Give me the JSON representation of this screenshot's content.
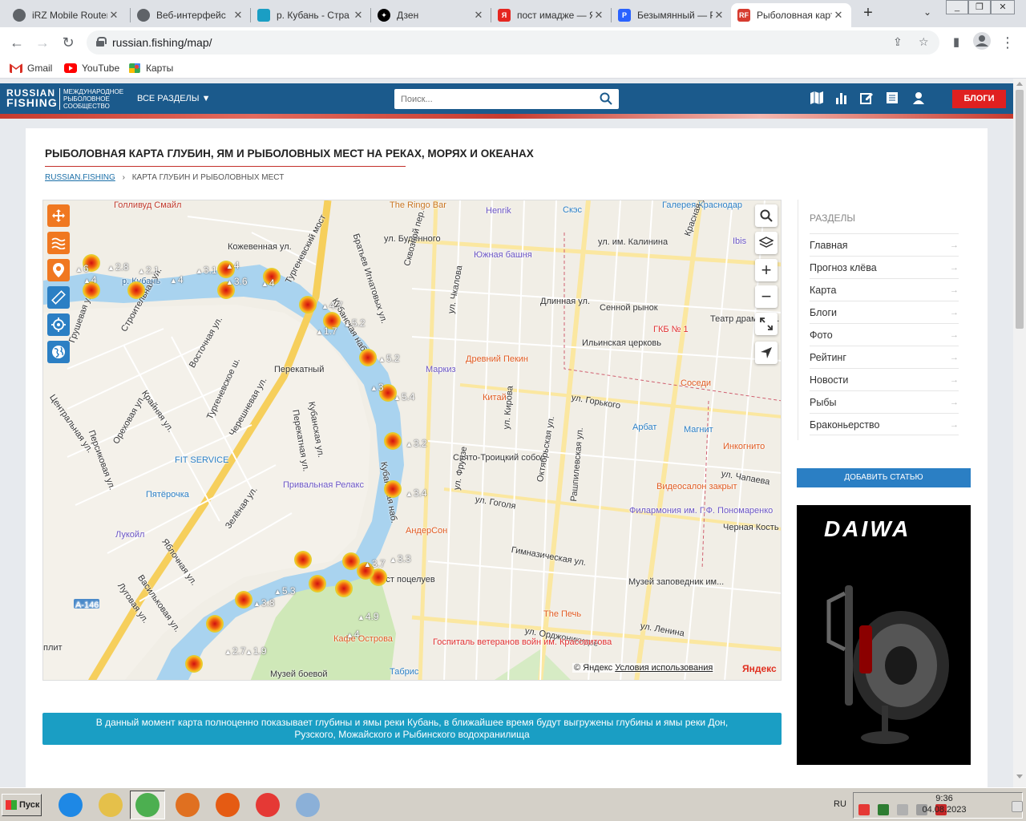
{
  "browser": {
    "tabs": [
      {
        "title": "iRZ Mobile Router",
        "active": false,
        "icon": "globe-icon",
        "color": "#5f6368"
      },
      {
        "title": "Веб-интерфейс",
        "active": false,
        "icon": "globe-icon",
        "color": "#5f6368"
      },
      {
        "title": "р. Кубань - Стра",
        "active": false,
        "icon": "chat-icon",
        "color": "#1a9ec4"
      },
      {
        "title": "Дзен",
        "active": false,
        "icon": "dzen-icon",
        "color": "#000000"
      },
      {
        "title": "пост имадже — Я",
        "active": false,
        "icon": "yandex-icon",
        "color": "#e52620"
      },
      {
        "title": "Безымянный — Р",
        "active": false,
        "icon": "doc-icon",
        "color": "#2962ff"
      },
      {
        "title": "Рыболовная карт",
        "active": true,
        "icon": "rf-icon",
        "color": "#d63b2f"
      }
    ],
    "url": "russian.fishing/map/",
    "bookmarks": [
      {
        "label": "Gmail",
        "icon": "gmail-icon",
        "color": "#d93025"
      },
      {
        "label": "YouTube",
        "icon": "youtube-icon",
        "color": "#ff0000"
      },
      {
        "label": "Карты",
        "icon": "maps-icon",
        "color": "#34a853"
      }
    ]
  },
  "site": {
    "logo_line1": "RUSSIAN",
    "logo_line2": "FISHING",
    "logo_sub": "МЕЖДУНАРОДНОЕ РЫБОЛОВНОЕ СООБЩЕСТВО",
    "all_sections": "ВСЕ РАЗДЕЛЫ ▼",
    "search_placeholder": "Поиск...",
    "blogs_button": "БЛОГИ",
    "page_title": "РЫБОЛОВНАЯ КАРТА ГЛУБИН, ЯМ И РЫБОЛОВНЫХ МЕСТ НА РЕКАХ, МОРЯХ И ОКЕАНАХ",
    "breadcrumb_home": "RUSSIAN.FISHING",
    "breadcrumb_sep": "›",
    "breadcrumb_current": "КАРТА ГЛУБИН И РЫБОЛОВНЫХ МЕСТ",
    "notice_line1": "В данный момент карта полноценно показывает глубины и ямы реки Кубань, в ближайшее время будут выгружены глубины и ямы реки Дон,",
    "notice_line2": "Рузского, Можайского и Рыбинского водохранилища",
    "sidebar_heading": "РАЗДЕЛЫ",
    "sidebar_items": [
      "Главная",
      "Прогноз клёва",
      "Карта",
      "Блоги",
      "Фото",
      "Рейтинг",
      "Новости",
      "Рыбы",
      "Браконьерство"
    ],
    "sidebar_arrow": "→",
    "add_article": "ДОБАВИТЬ СТАТЬЮ",
    "ad_brand": "DAIWA"
  },
  "map": {
    "copyright": "© Яндекс",
    "terms": "Условия использования",
    "yandex_logo": "Яндекс",
    "labels": [
      {
        "text": "Голливуд Смайл",
        "color": "#c0392b"
      },
      {
        "text": "The Ringo Bar",
        "color": "#c87420"
      },
      {
        "text": "Henrik",
        "color": "#6b55c4"
      },
      {
        "text": "Скэс",
        "color": "#2b7fc4"
      },
      {
        "text": "Галерея Краснодар",
        "color": "#2b7fc4"
      },
      {
        "text": "ул. Будённого",
        "color": "#333333"
      },
      {
        "text": "ул. им. Калинина",
        "color": "#333333"
      },
      {
        "text": "Красная ул.",
        "color": "#333333"
      },
      {
        "text": "Ibis",
        "color": "#6b55c4"
      },
      {
        "text": "Кожевенная ул.",
        "color": "#333333"
      },
      {
        "text": "Тургеневский мост",
        "color": "#333333"
      },
      {
        "text": "Братьев Игнатовых ул.",
        "color": "#333333"
      },
      {
        "text": "Сквозной пер.",
        "color": "#333333"
      },
      {
        "text": "Кубанская наб.",
        "color": "#333333"
      },
      {
        "text": "Южная башня",
        "color": "#6b55c4"
      },
      {
        "text": "Сенной рынок",
        "color": "#333333"
      },
      {
        "text": "ГКБ № 1",
        "color": "#e03030"
      },
      {
        "text": "Театр драмы им. Горького",
        "color": "#333333"
      },
      {
        "text": "Длинная ул.",
        "color": "#333333"
      },
      {
        "text": "Перекатный",
        "color": "#333333"
      },
      {
        "text": "Тургеневское ш.",
        "color": "#333333"
      },
      {
        "text": "Маркиз",
        "color": "#6b55c4"
      },
      {
        "text": "Древний Пекин",
        "color": "#e05a20"
      },
      {
        "text": "Ильинская церковь",
        "color": "#333333"
      },
      {
        "text": "Китай",
        "color": "#e05a20"
      },
      {
        "text": "ул. Чкалова",
        "color": "#333333"
      },
      {
        "text": "Соседи",
        "color": "#e05a20"
      },
      {
        "text": "ул. Горького",
        "color": "#333333"
      },
      {
        "text": "Арбат",
        "color": "#2b7fc4"
      },
      {
        "text": "Магнит",
        "color": "#2b7fc4"
      },
      {
        "text": "Инкогнито",
        "color": "#e05a20"
      },
      {
        "text": "Свято-Троицкий собор",
        "color": "#333333"
      },
      {
        "text": "ул. Кирова",
        "color": "#333333"
      },
      {
        "text": "Октябрьская ул.",
        "color": "#333333"
      },
      {
        "text": "ул. Чапаева",
        "color": "#333333"
      },
      {
        "text": "FIT SERVICE",
        "color": "#2b7fc4"
      },
      {
        "text": "Черешневая ул.",
        "color": "#333333"
      },
      {
        "text": "Привальная Релакс",
        "color": "#6b55c4"
      },
      {
        "text": "Пятёрочка",
        "color": "#2b7fc4"
      },
      {
        "text": "Видеосалон закрыт",
        "color": "#e05a20"
      },
      {
        "text": "ул. Гоголя",
        "color": "#333333"
      },
      {
        "text": "ул. Фрунзе",
        "color": "#333333"
      },
      {
        "text": "Рашпилевская ул.",
        "color": "#333333"
      },
      {
        "text": "Филармония им. Г.Ф. Пономаренко",
        "color": "#6b55c4"
      },
      {
        "text": "Черная Кость",
        "color": "#333333"
      },
      {
        "text": "Лукойл",
        "color": "#6b55c4"
      },
      {
        "text": "АндерСон",
        "color": "#e05a20"
      },
      {
        "text": "Гимназическая ул.",
        "color": "#333333"
      },
      {
        "text": "Мост поцелуев",
        "color": "#333333"
      },
      {
        "text": "Музей заповедник им...",
        "color": "#333333"
      },
      {
        "text": "Зелёная ул.",
        "color": "#333333"
      },
      {
        "text": "Яблочная ул.",
        "color": "#333333"
      },
      {
        "text": "Васильковая ул.",
        "color": "#333333"
      },
      {
        "text": "Луговая ул.",
        "color": "#333333"
      },
      {
        "text": "А-146",
        "color": "#ffffff"
      },
      {
        "text": "The Печь",
        "color": "#e05a20"
      },
      {
        "text": "ул. Орджоникидзе",
        "color": "#333333"
      },
      {
        "text": "ул. Ленина",
        "color": "#333333"
      },
      {
        "text": "Кафе Острова",
        "color": "#e05a20"
      },
      {
        "text": "Госпиталь ветеранов войн им. Красовитова",
        "color": "#e03030"
      },
      {
        "text": "Музей боевой",
        "color": "#333333"
      },
      {
        "text": "Табрис",
        "color": "#2b7fc4"
      },
      {
        "text": "Строительная ул.",
        "color": "#333333"
      },
      {
        "text": "Центральная ул.",
        "color": "#333333"
      },
      {
        "text": "Восточная ул.",
        "color": "#333333"
      },
      {
        "text": "Крайняя ул.",
        "color": "#333333"
      },
      {
        "text": "Персиковая ул.",
        "color": "#333333"
      },
      {
        "text": "Ореховая ул.",
        "color": "#333333"
      },
      {
        "text": "Грушевая ул.",
        "color": "#333333"
      },
      {
        "text": "Перекатная ул.",
        "color": "#333333"
      },
      {
        "text": "Кубанская ул.",
        "color": "#333333"
      },
      {
        "text": "Кубанская наб.",
        "color": "#333333"
      },
      {
        "text": "р. Кубань",
        "color": "#3a6e9c"
      },
      {
        "text": "плит",
        "color": "#333333"
      }
    ],
    "depth_marks": [
      "6",
      "4",
      "2.8",
      "2.1",
      "4",
      "3.1",
      "3.6",
      "4",
      "4",
      "4.7",
      "5.2",
      "1.7",
      "5.2",
      "3",
      "5.4",
      "3.2",
      "3.4",
      "3.7",
      "3.3",
      "5.3",
      "3.8",
      "4.9",
      "4",
      "2.7",
      "1.9"
    ]
  },
  "taskbar": {
    "start_label": "Пуск",
    "lang": "RU",
    "time": "9:36",
    "date": "04.08.2023",
    "apps": [
      {
        "name": "ie-icon",
        "color": "#1e88e5"
      },
      {
        "name": "explorer-icon",
        "color": "#e5c04a"
      },
      {
        "name": "chrome-icon",
        "color": "#4caf50"
      },
      {
        "name": "media-player-icon",
        "color": "#e07020"
      },
      {
        "name": "firefox-icon",
        "color": "#e55b13"
      },
      {
        "name": "anydesk-icon",
        "color": "#e53935"
      },
      {
        "name": "paint-icon",
        "color": "#8bb0d8"
      }
    ]
  }
}
